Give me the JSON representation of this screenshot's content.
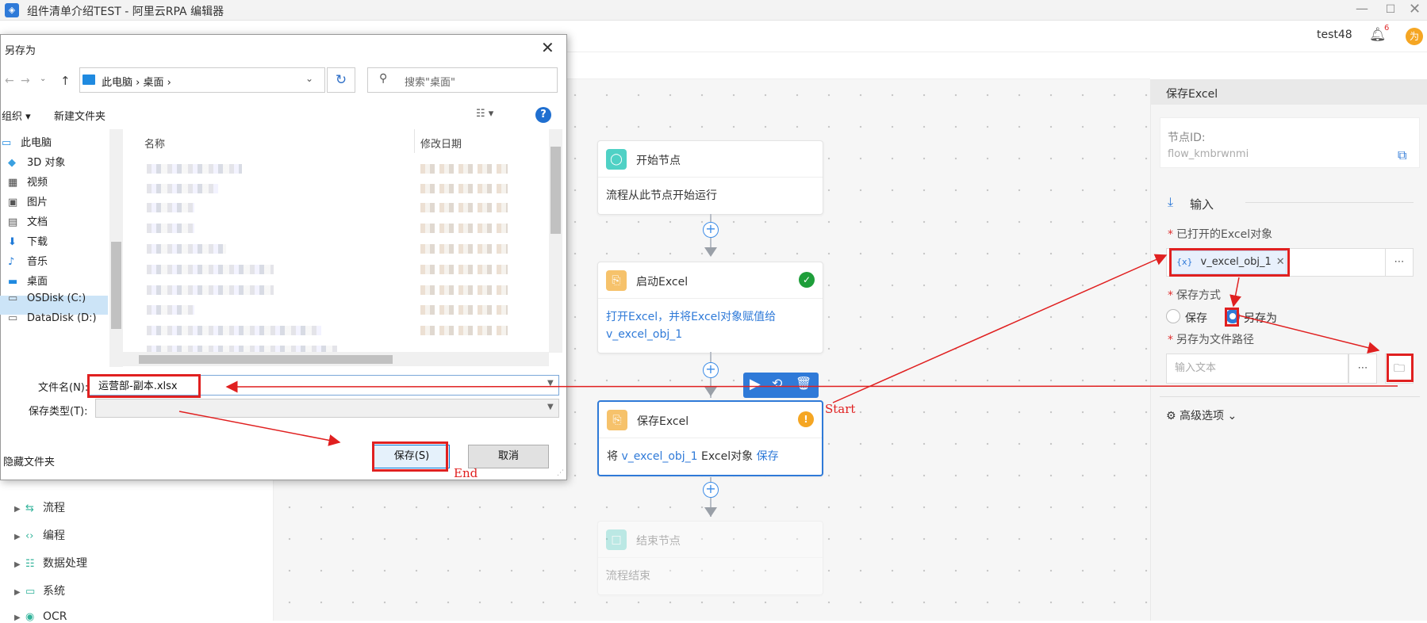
{
  "window": {
    "title": "组件清单介绍TEST - 阿里云RPA 编辑器",
    "min_icon": "minimize-icon",
    "max_icon": "maximize-icon",
    "close_icon": "close-icon"
  },
  "header": {
    "user": "test48",
    "notification_count": "6",
    "avatar_text": "为"
  },
  "sidebar": {
    "items": [
      {
        "label": "流程",
        "icon": "flow-icon"
      },
      {
        "label": "编程",
        "icon": "code-icon"
      },
      {
        "label": "数据处理",
        "icon": "data-icon"
      },
      {
        "label": "系统",
        "icon": "monitor-icon"
      },
      {
        "label": "OCR",
        "icon": "eye-icon"
      }
    ]
  },
  "flow": {
    "start": {
      "title": "开始节点",
      "body": "流程从此节点开始运行"
    },
    "launch": {
      "title": "启动Excel",
      "body_text": "打开Excel，并将Excel对象赋值给",
      "body_var": "v_excel_obj_1"
    },
    "save": {
      "title": "保存Excel",
      "body_prefix": "将 ",
      "body_var": "v_excel_obj_1",
      "body_mid": " Excel对象 ",
      "body_action": "保存"
    },
    "end": {
      "title": "结束节点",
      "body": "流程结束"
    }
  },
  "panel": {
    "title": "保存Excel",
    "node_id_label": "节点ID:",
    "node_id": "flow_kmbrwnmi",
    "input_section": "输入",
    "excel_label": "已打开的Excel对象",
    "excel_var_icon": "{x}",
    "excel_var": "v_excel_obj_1",
    "save_mode_label": "保存方式",
    "option_save": "保存",
    "option_saveas": "另存为",
    "path_label": "另存为文件路径",
    "path_placeholder": "输入文本",
    "advanced": "高级选项"
  },
  "dialog": {
    "title": "另存为",
    "breadcrumb": "此电脑  ›  桌面  ›",
    "search_placeholder": "搜索\"桌面\"",
    "organize": "组织 ▾",
    "new_folder": "新建文件夹",
    "tree": [
      "此电脑",
      "3D 对象",
      "视频",
      "图片",
      "文档",
      "下载",
      "音乐",
      "桌面",
      "OSDisk (C:)",
      "DataDisk (D:)"
    ],
    "col_name": "名称",
    "col_date": "修改日期",
    "filename_label": "文件名(N):",
    "filename_value": "运营部-副本.xlsx",
    "filetype_label": "保存类型(T):",
    "hide_folders": "隐藏文件夹",
    "save_btn": "保存(S)",
    "cancel_btn": "取消"
  },
  "annotations": {
    "start": "Start",
    "end": "End",
    "color": "#e02020"
  }
}
